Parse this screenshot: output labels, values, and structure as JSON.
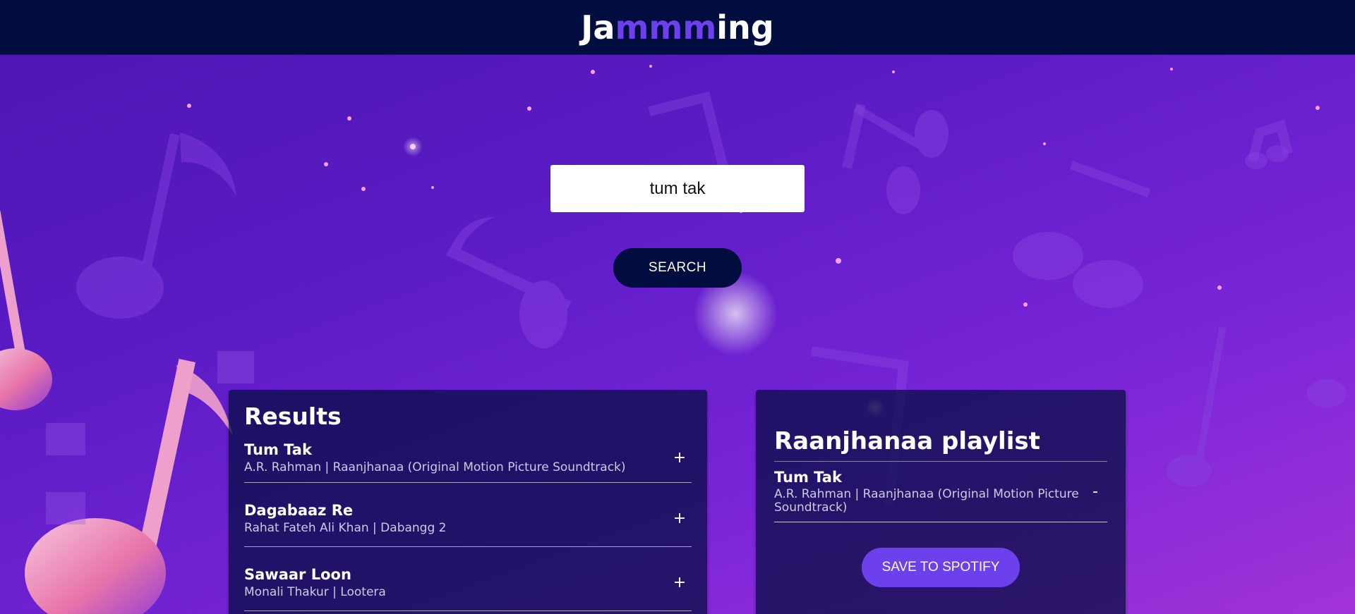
{
  "header": {
    "logo_prefix": "Ja",
    "logo_accent": "mmm",
    "logo_suffix": "ing"
  },
  "search": {
    "value": "tum tak",
    "button_label": "SEARCH"
  },
  "results": {
    "title": "Results",
    "tracks": [
      {
        "name": "Tum Tak",
        "meta": "A.R. Rahman | Raanjhanaa (Original Motion Picture Soundtrack)",
        "action": "+"
      },
      {
        "name": "Dagabaaz Re",
        "meta": "Rahat Fateh Ali Khan | Dabangg 2",
        "action": "+"
      },
      {
        "name": "Sawaar Loon",
        "meta": "Monali Thakur | Lootera",
        "action": "+"
      }
    ]
  },
  "playlist": {
    "title": "Raanjhanaa playlist",
    "tracks": [
      {
        "name": "Tum Tak",
        "meta": "A.R. Rahman | Raanjhanaa (Original Motion Picture Soundtrack)",
        "action": "-"
      }
    ],
    "save_label": "SAVE TO SPOTIFY"
  },
  "colors": {
    "header_bg": "#010c3f",
    "accent": "#6c41ec",
    "panel_bg": "#010c3f"
  },
  "icons": {
    "background": "music-notes-illustration"
  }
}
